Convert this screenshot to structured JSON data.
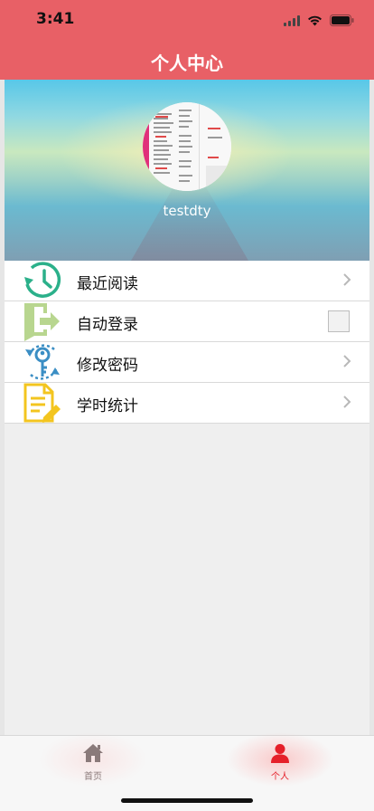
{
  "status_bar": {
    "time": "3:41"
  },
  "nav": {
    "title": "个人中心"
  },
  "profile": {
    "username": "testdty"
  },
  "menu": {
    "items": [
      {
        "label": "最近阅读",
        "icon": "clock-history-icon",
        "accessory": "chevron"
      },
      {
        "label": "自动登录",
        "icon": "login-door-icon",
        "accessory": "checkbox",
        "checked": false
      },
      {
        "label": "修改密码",
        "icon": "key-refresh-icon",
        "accessory": "chevron"
      },
      {
        "label": "学时统计",
        "icon": "document-edit-icon",
        "accessory": "chevron"
      }
    ]
  },
  "tabs": [
    {
      "label": "首页",
      "icon": "home-icon",
      "selected": false
    },
    {
      "label": "个人",
      "icon": "person-icon",
      "selected": true
    }
  ],
  "colors": {
    "header": "#e86066",
    "tab_selected": "#e5202a",
    "tab_unselected": "#8a7a7a",
    "menu_icon_green": "#2bb08a",
    "menu_icon_yellow": "#f3c51f"
  }
}
